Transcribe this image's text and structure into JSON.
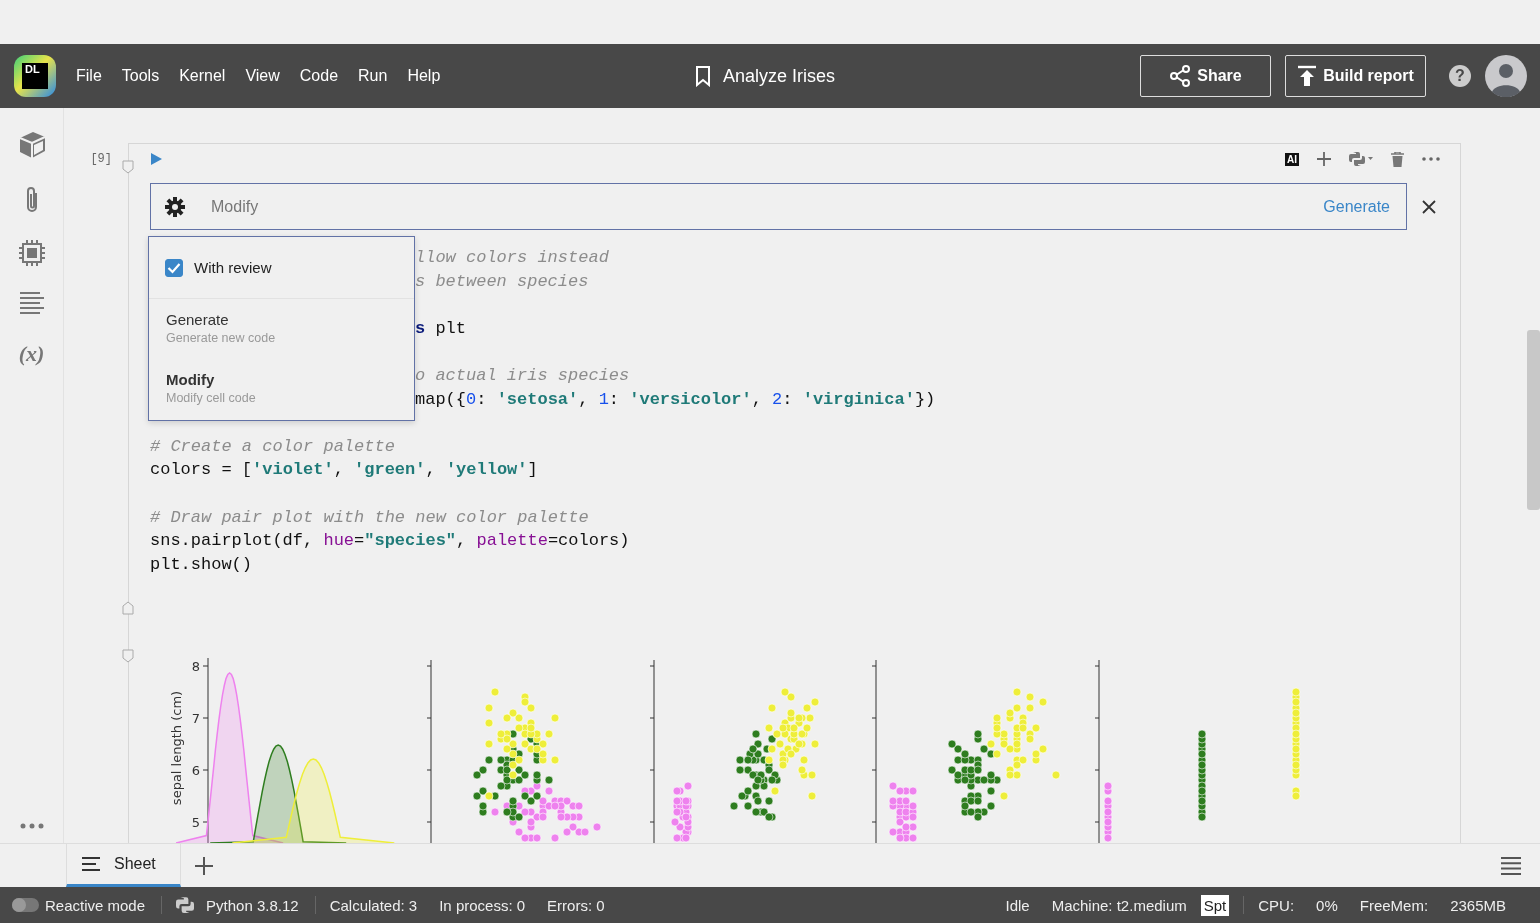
{
  "header": {
    "logo": "DL",
    "menu": [
      "File",
      "Tools",
      "Kernel",
      "View",
      "Code",
      "Run",
      "Help"
    ],
    "title": "Analyze Irises",
    "share": "Share",
    "build_report": "Build report",
    "help": "?"
  },
  "sidebar": {
    "variables": "(x)"
  },
  "cell": {
    "execution_count": "[9]",
    "ai_badge": "AI",
    "prompt": {
      "placeholder": "Modify",
      "action": "Generate"
    },
    "popup": {
      "review": {
        "label": "With review",
        "checked": true
      },
      "options": [
        {
          "title": "Generate",
          "subtitle": "Generate new code",
          "selected": false
        },
        {
          "title": "Modify",
          "subtitle": "Modify cell code",
          "selected": true
        }
      ]
    },
    "lines": [
      {
        "kind": "partial",
        "tokens": [
          {
            "kind": "comment",
            "text": "llow colors instead"
          }
        ]
      },
      {
        "kind": "partial",
        "tokens": [
          {
            "kind": "comment",
            "text": "s between species"
          }
        ]
      },
      {
        "kind": "blank"
      },
      {
        "kind": "partial",
        "tokens": [
          {
            "kind": "keyword",
            "text": "s"
          },
          {
            "kind": "plain",
            "text": " plt"
          }
        ]
      },
      {
        "kind": "blank"
      },
      {
        "kind": "partial",
        "tokens": [
          {
            "kind": "comment",
            "text": "o actual iris species"
          }
        ]
      },
      {
        "kind": "partial",
        "tokens": [
          {
            "kind": "plain",
            "text": "map({"
          },
          {
            "kind": "number",
            "text": "0"
          },
          {
            "kind": "plain",
            "text": ": "
          },
          {
            "kind": "string",
            "text": "'setosa'"
          },
          {
            "kind": "plain",
            "text": ", "
          },
          {
            "kind": "number",
            "text": "1"
          },
          {
            "kind": "plain",
            "text": ": "
          },
          {
            "kind": "string",
            "text": "'versicolor'"
          },
          {
            "kind": "plain",
            "text": ", "
          },
          {
            "kind": "number",
            "text": "2"
          },
          {
            "kind": "plain",
            "text": ": "
          },
          {
            "kind": "string",
            "text": "'virginica'"
          },
          {
            "kind": "plain",
            "text": "})"
          }
        ]
      },
      {
        "kind": "blank"
      },
      {
        "kind": "code",
        "tokens": [
          {
            "kind": "comment",
            "text": "# Create a color palette"
          }
        ]
      },
      {
        "kind": "code",
        "tokens": [
          {
            "kind": "plain",
            "text": "colors = ["
          },
          {
            "kind": "string",
            "text": "'violet'"
          },
          {
            "kind": "plain",
            "text": ", "
          },
          {
            "kind": "string",
            "text": "'green'"
          },
          {
            "kind": "plain",
            "text": ", "
          },
          {
            "kind": "string",
            "text": "'yellow'"
          },
          {
            "kind": "plain",
            "text": "]"
          }
        ]
      },
      {
        "kind": "blank"
      },
      {
        "kind": "code",
        "tokens": [
          {
            "kind": "comment",
            "text": "# Draw pair plot with the new color palette"
          }
        ]
      },
      {
        "kind": "code",
        "tokens": [
          {
            "kind": "plain",
            "text": "sns.pairplot(df, "
          },
          {
            "kind": "param",
            "text": "hue"
          },
          {
            "kind": "plain",
            "text": "="
          },
          {
            "kind": "string",
            "text": "\"species\""
          },
          {
            "kind": "plain",
            "text": ", "
          },
          {
            "kind": "param",
            "text": "palette"
          },
          {
            "kind": "plain",
            "text": "=colors)"
          }
        ]
      },
      {
        "kind": "code",
        "tokens": [
          {
            "kind": "plain",
            "text": "plt.show()"
          }
        ]
      }
    ],
    "plot": {
      "kind": "pairplot",
      "ylabel": "sepal length (cm)",
      "yticks": [
        "8",
        "7",
        "6",
        "5"
      ],
      "series": [
        {
          "color": "#ee82ee"
        },
        {
          "color": "#2e7d1f"
        },
        {
          "color": "#eeee3a"
        }
      ]
    }
  },
  "sheets": [
    {
      "label": "Sheet",
      "selected": true
    }
  ],
  "status_bar": {
    "reactive_mode": {
      "label": "Reactive mode",
      "on": false
    },
    "python": "Python 3.8.12",
    "calculated": "Calculated: 3",
    "in_process": "In process: 0",
    "errors": "Errors: 0",
    "state": "Idle",
    "machine": "Machine: t2.medium",
    "spot": "Spt",
    "cpu_label": "CPU:",
    "cpu": "0%",
    "mem_label": "FreeMem:",
    "mem": "2365MB"
  }
}
